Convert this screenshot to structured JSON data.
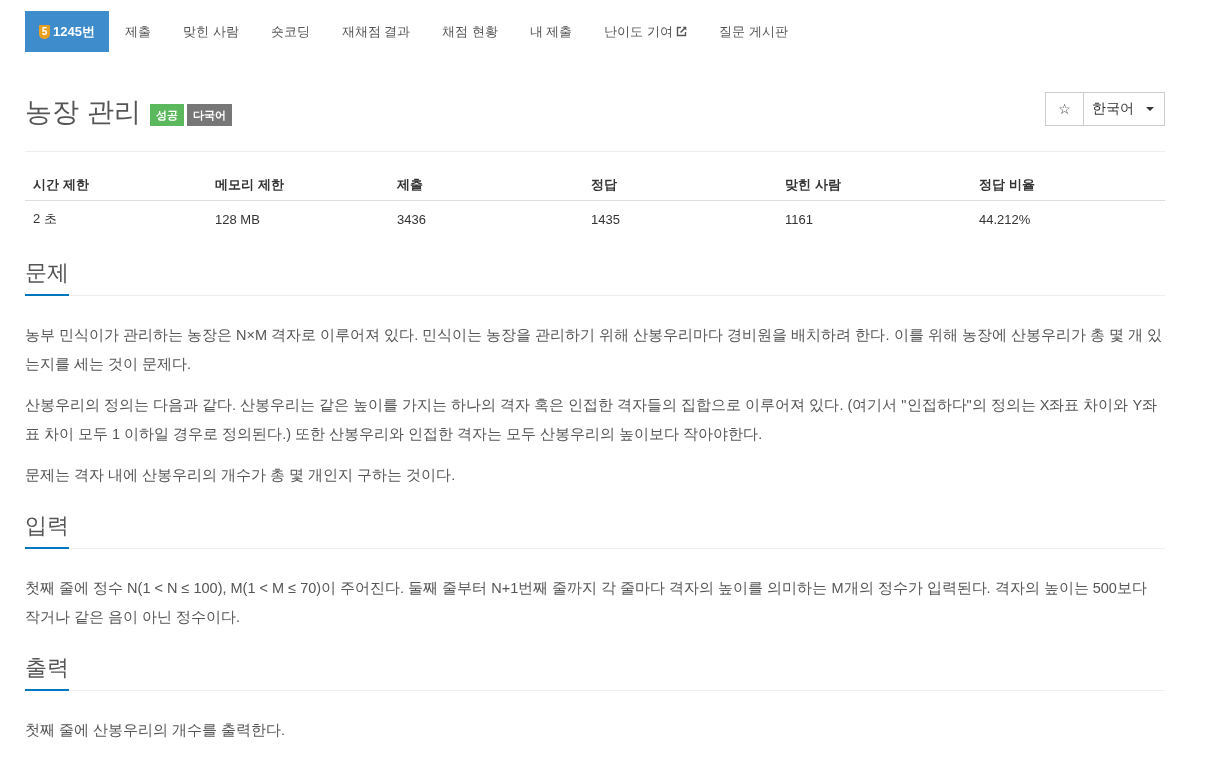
{
  "nav": {
    "tabs": [
      {
        "label": "1245번",
        "selected": true,
        "tier": "5",
        "external": false
      },
      {
        "label": "제출",
        "selected": false,
        "external": false
      },
      {
        "label": "맞힌 사람",
        "selected": false,
        "external": false
      },
      {
        "label": "숏코딩",
        "selected": false,
        "external": false
      },
      {
        "label": "재채점 결과",
        "selected": false,
        "external": false
      },
      {
        "label": "채점 현황",
        "selected": false,
        "external": false
      },
      {
        "label": "내 제출",
        "selected": false,
        "external": false
      },
      {
        "label": "난이도 기여",
        "selected": false,
        "external": true
      },
      {
        "label": "질문 게시판",
        "selected": false,
        "external": false
      }
    ]
  },
  "problem": {
    "title": "농장 관리",
    "tags": [
      {
        "label": "성공",
        "color": "#5cb85c"
      },
      {
        "label": "다국어",
        "color": "#777777"
      }
    ]
  },
  "actions": {
    "favorite": "☆",
    "language": "한국어"
  },
  "info_table": {
    "columns": [
      "시간 제한",
      "메모리 제한",
      "제출",
      "정답",
      "맞힌 사람",
      "정답 비율"
    ],
    "rows": [
      [
        "2 초",
        "128 MB",
        "3436",
        "1435",
        "1161",
        "44.212%"
      ]
    ]
  },
  "sections": [
    {
      "heading": "문제",
      "paragraphs": [
        "농부 민식이가 관리하는 농장은 N×M 격자로 이루어져 있다. 민식이는 농장을 관리하기 위해 산봉우리마다 경비원을 배치하려 한다. 이를 위해 농장에 산봉우리가 총 몇 개 있는지를 세는 것이 문제다.",
        "산봉우리의 정의는 다음과 같다. 산봉우리는 같은 높이를 가지는 하나의 격자 혹은 인접한 격자들의 집합으로 이루어져 있다. (여기서 \"인접하다\"의 정의는 X좌표 차이와 Y좌표 차이 모두 1 이하일 경우로 정의된다.) 또한 산봉우리와 인접한 격자는 모두 산봉우리의 높이보다 작아야한다.",
        "문제는 격자 내에 산봉우리의 개수가 총 몇 개인지 구하는 것이다."
      ]
    },
    {
      "heading": "입력",
      "paragraphs": [
        "첫째 줄에 정수 N(1 < N ≤ 100), M(1 < M ≤ 70)이 주어진다. 둘째 줄부터 N+1번째 줄까지 각 줄마다 격자의 높이를 의미하는 M개의 정수가 입력된다. 격자의 높이는 500보다 작거나 같은 음이 아닌 정수이다."
      ]
    },
    {
      "heading": "출력",
      "paragraphs": [
        "첫째 줄에 산봉우리의 개수를 출력한다."
      ]
    }
  ]
}
